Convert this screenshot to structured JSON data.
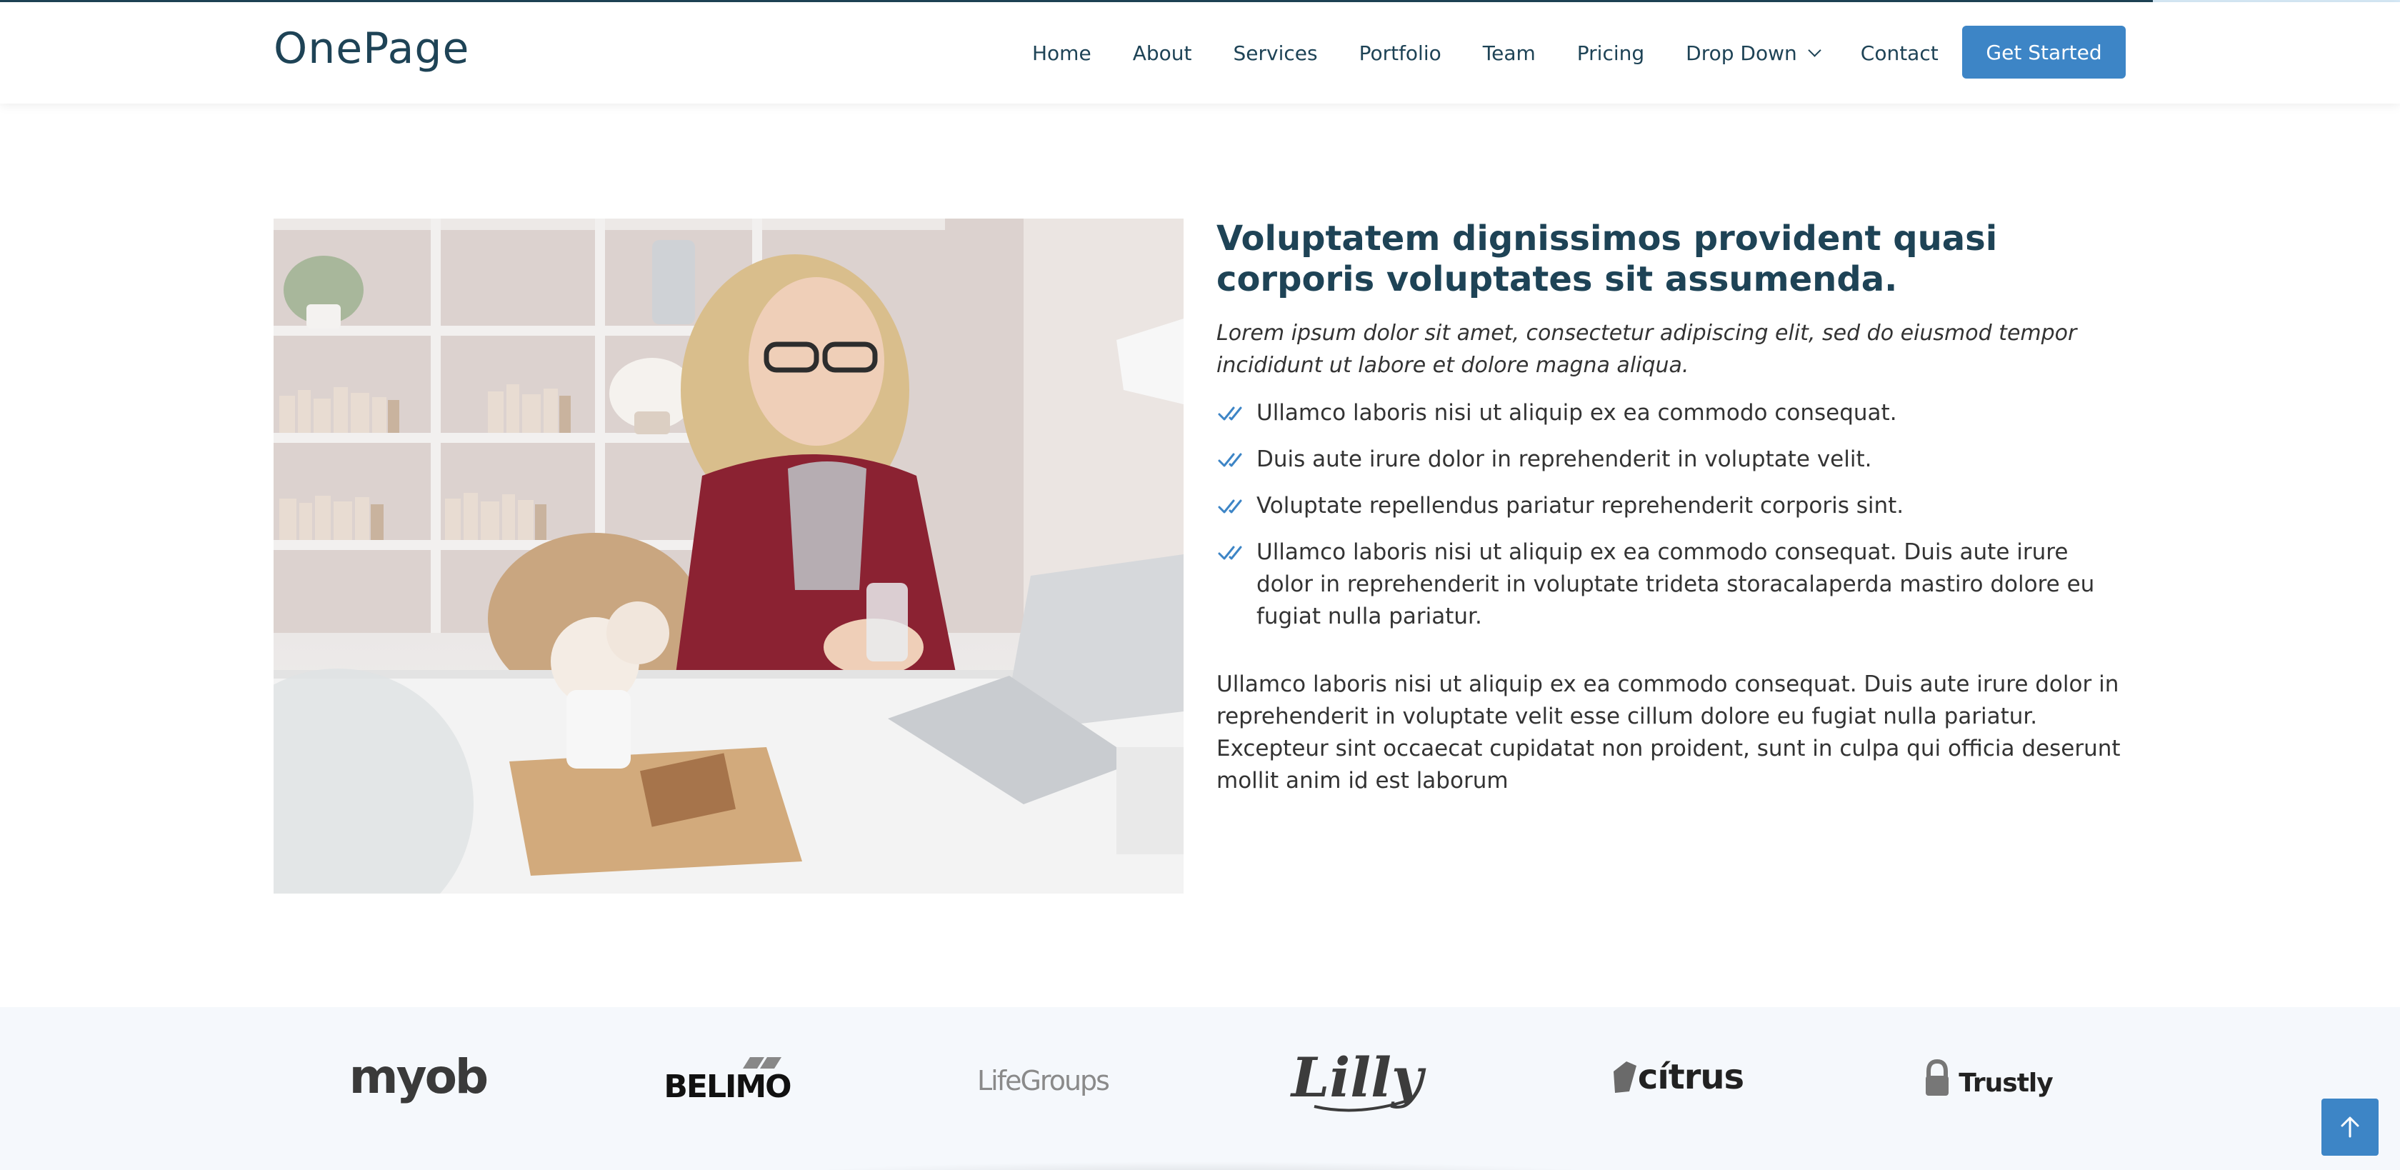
{
  "scroll_progress": 0.897,
  "brand": {
    "logo": "OnePage"
  },
  "nav": {
    "items": [
      {
        "label": "Home"
      },
      {
        "label": "About"
      },
      {
        "label": "Services"
      },
      {
        "label": "Portfolio"
      },
      {
        "label": "Team"
      },
      {
        "label": "Pricing"
      },
      {
        "label": "Drop Down"
      },
      {
        "label": "Contact"
      }
    ],
    "cta": "Get Started"
  },
  "about": {
    "image_alt": "Woman with glasses smiling at her laptop at a white desk",
    "title": "Voluptatem dignissimos provident quasi corporis voluptates sit assumenda.",
    "lead": "Lorem ipsum dolor sit amet, consectetur adipiscing elit, sed do eiusmod tempor incididunt ut labore et dolore magna aliqua.",
    "checklist": [
      "Ullamco laboris nisi ut aliquip ex ea commodo consequat.",
      "Duis aute irure dolor in reprehenderit in voluptate velit.",
      "Voluptate repellendus pariatur reprehenderit corporis sint.",
      "Ullamco laboris nisi ut aliquip ex ea commodo consequat. Duis aute irure dolor in reprehenderit in voluptate trideta storacalaperda mastiro dolore eu fugiat nulla pariatur."
    ],
    "paragraph": "Ullamco laboris nisi ut aliquip ex ea commodo consequat. Duis aute irure dolor in reprehenderit in voluptate velit esse cillum dolore eu fugiat nulla pariatur. Excepteur sint occaecat cupidatat non proident, sunt in culpa qui officia deserunt mollit anim id est laborum"
  },
  "clients": {
    "logos": [
      {
        "name": "myob"
      },
      {
        "name": "BELIMO"
      },
      {
        "name": "LifeGroups"
      },
      {
        "name": "Lilly"
      },
      {
        "name": "citrus"
      },
      {
        "name": "Trustly"
      }
    ]
  },
  "icons": {
    "check": "double-check-icon",
    "back_to_top": "arrow-up-icon",
    "dropdown": "chevron-down-icon"
  },
  "colors": {
    "brand": "#1e4356",
    "accent": "#3d85c6",
    "clients_bg": "#f5f8fc"
  }
}
